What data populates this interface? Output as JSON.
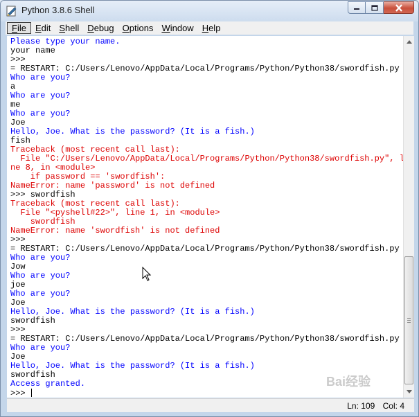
{
  "window": {
    "title": "Python 3.8.6 Shell"
  },
  "menu": [
    {
      "label": "File",
      "mnemonic": "F",
      "rest": "ile"
    },
    {
      "label": "Edit",
      "mnemonic": "E",
      "rest": "dit"
    },
    {
      "label": "Shell",
      "mnemonic": "S",
      "rest": "hell"
    },
    {
      "label": "Debug",
      "mnemonic": "D",
      "rest": "ebug"
    },
    {
      "label": "Options",
      "mnemonic": "O",
      "rest": "ptions"
    },
    {
      "label": "Window",
      "mnemonic": "W",
      "rest": "indow"
    },
    {
      "label": "Help",
      "mnemonic": "H",
      "rest": "elp"
    }
  ],
  "shell": {
    "lines": [
      {
        "kind": "out",
        "text": "Please type your name."
      },
      {
        "kind": "in",
        "text": "your name"
      },
      {
        "kind": "in",
        "text": ">>> "
      },
      {
        "kind": "in",
        "text": "= RESTART: C:/Users/Lenovo/AppData/Local/Programs/Python/Python38/swordfish.py ="
      },
      {
        "kind": "out",
        "text": "Who are you?"
      },
      {
        "kind": "in",
        "text": "a"
      },
      {
        "kind": "out",
        "text": "Who are you?"
      },
      {
        "kind": "in",
        "text": "me"
      },
      {
        "kind": "out",
        "text": "Who are you?"
      },
      {
        "kind": "in",
        "text": "Joe"
      },
      {
        "kind": "out",
        "text": "Hello, Joe. What is the password? (It is a fish.)"
      },
      {
        "kind": "in",
        "text": "fish"
      },
      {
        "kind": "err",
        "text": "Traceback (most recent call last):"
      },
      {
        "kind": "err",
        "text": "  File \"C:/Users/Lenovo/AppData/Local/Programs/Python/Python38/swordfish.py\", li"
      },
      {
        "kind": "err",
        "text": "ne 8, in <module>"
      },
      {
        "kind": "err",
        "text": "    if password == 'swordfish':"
      },
      {
        "kind": "err",
        "text": "NameError: name 'password' is not defined"
      },
      {
        "kind": "in",
        "text": ">>> swordfish"
      },
      {
        "kind": "err",
        "text": "Traceback (most recent call last):"
      },
      {
        "kind": "err",
        "text": "  File \"<pyshell#22>\", line 1, in <module>"
      },
      {
        "kind": "err",
        "text": "    swordfish"
      },
      {
        "kind": "err",
        "text": "NameError: name 'swordfish' is not defined"
      },
      {
        "kind": "in",
        "text": ">>> "
      },
      {
        "kind": "in",
        "text": "= RESTART: C:/Users/Lenovo/AppData/Local/Programs/Python/Python38/swordfish.py ="
      },
      {
        "kind": "out",
        "text": "Who are you?"
      },
      {
        "kind": "in",
        "text": "Jow"
      },
      {
        "kind": "out",
        "text": "Who are you?"
      },
      {
        "kind": "in",
        "text": "joe"
      },
      {
        "kind": "out",
        "text": "Who are you?"
      },
      {
        "kind": "in",
        "text": "Joe"
      },
      {
        "kind": "out",
        "text": "Hello, Joe. What is the password? (It is a fish.)"
      },
      {
        "kind": "in",
        "text": "swordfish"
      },
      {
        "kind": "in",
        "text": ">>> "
      },
      {
        "kind": "in",
        "text": "= RESTART: C:/Users/Lenovo/AppData/Local/Programs/Python/Python38/swordfish.py ="
      },
      {
        "kind": "out",
        "text": "Who are you?"
      },
      {
        "kind": "in",
        "text": "Joe"
      },
      {
        "kind": "out",
        "text": "Hello, Joe. What is the password? (It is a fish.)"
      },
      {
        "kind": "in",
        "text": "swordfish"
      },
      {
        "kind": "out",
        "text": "Access granted."
      }
    ],
    "prompt": ">>> ",
    "colors": {
      "output": "#0000ff",
      "input": "#000000",
      "error": "#dd0000"
    }
  },
  "status": {
    "line": "Ln: 109",
    "col": "Col: 4"
  },
  "watermark": "Bai经验"
}
